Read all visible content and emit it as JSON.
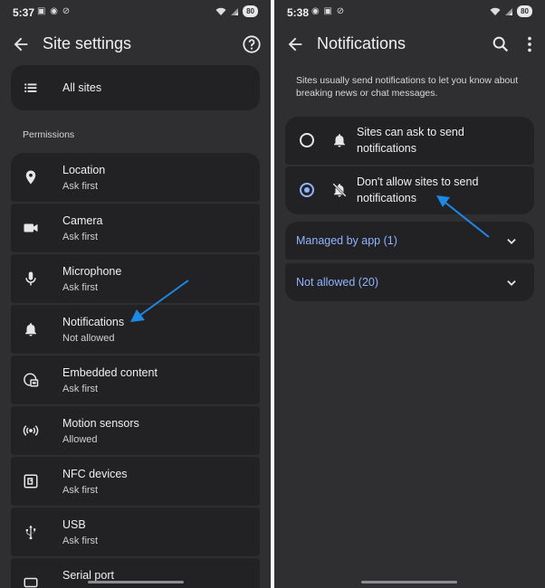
{
  "left": {
    "status": {
      "time": "5:37",
      "battery": "80"
    },
    "appbar": {
      "title": "Site settings"
    },
    "all_sites": {
      "label": "All sites"
    },
    "section_label": "Permissions",
    "permissions": [
      {
        "title": "Location",
        "subtitle": "Ask first",
        "icon": "location-pin-icon"
      },
      {
        "title": "Camera",
        "subtitle": "Ask first",
        "icon": "camera-icon"
      },
      {
        "title": "Microphone",
        "subtitle": "Ask first",
        "icon": "microphone-icon"
      },
      {
        "title": "Notifications",
        "subtitle": "Not allowed",
        "icon": "bell-icon"
      },
      {
        "title": "Embedded content",
        "subtitle": "Ask first",
        "icon": "embedded-content-icon"
      },
      {
        "title": "Motion sensors",
        "subtitle": "Allowed",
        "icon": "motion-sensors-icon"
      },
      {
        "title": "NFC devices",
        "subtitle": "Ask first",
        "icon": "nfc-icon"
      },
      {
        "title": "USB",
        "subtitle": "Ask first",
        "icon": "usb-icon"
      },
      {
        "title": "Serial port",
        "subtitle": "",
        "icon": "serial-port-icon"
      }
    ]
  },
  "right": {
    "status": {
      "time": "5:38",
      "battery": "80"
    },
    "appbar": {
      "title": "Notifications"
    },
    "intro": "Sites usually send notifications to let you know about breaking news or chat messages.",
    "options": [
      {
        "label": "Sites can ask to send notifications",
        "selected": false,
        "icon": "bell-icon"
      },
      {
        "label": "Don't allow sites to send notifications",
        "selected": true,
        "icon": "bell-off-icon"
      }
    ],
    "expanders": [
      {
        "label": "Managed by app (1)"
      },
      {
        "label": "Not allowed (20)"
      }
    ]
  },
  "colors": {
    "background": "#2f2f32",
    "card": "#222225",
    "accent": "#8fb4ff",
    "annotation_arrow": "#1e88e5"
  }
}
